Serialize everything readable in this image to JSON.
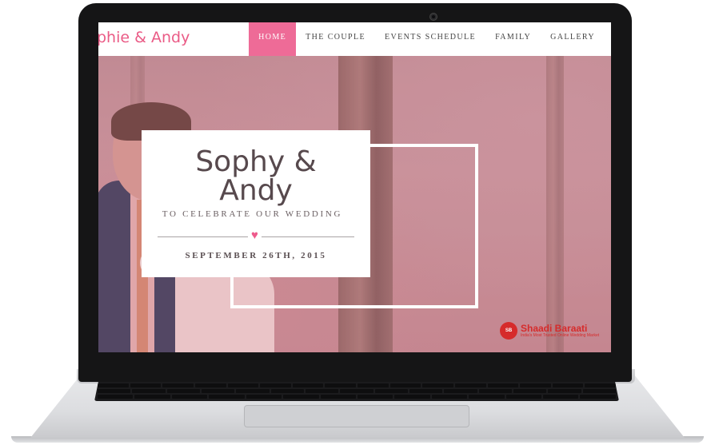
{
  "site": {
    "brand": "phie & Andy",
    "nav": [
      {
        "label": "Home",
        "active": true
      },
      {
        "label": "The Couple",
        "active": false
      },
      {
        "label": "Events Schedule",
        "active": false
      },
      {
        "label": "Family",
        "active": false
      },
      {
        "label": "Gallery",
        "active": false
      }
    ]
  },
  "hero": {
    "names_line1": "Sophy &",
    "names_line2": "Andy",
    "tagline": "TO CELEBRATE OUR WEDDING",
    "heart": "♥",
    "date": "SEPTEMBER 26TH, 2015"
  },
  "watermark": {
    "brand": "Shaadi Baraati",
    "tagline": "India's Most Trusted Online Wedding Market",
    "logo_text": "SB"
  },
  "colors": {
    "accent": "#ee6b97",
    "brand_text": "#ea5b86",
    "overlay": "#d67c92",
    "card_text": "#57494d"
  }
}
